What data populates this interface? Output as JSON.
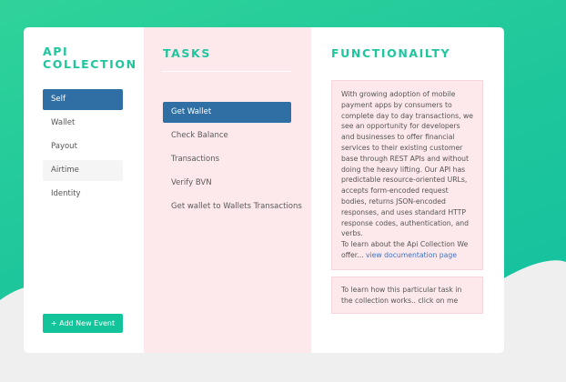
{
  "api": {
    "title": "API COLLECTION",
    "items": [
      {
        "label": "Self",
        "state": "active"
      },
      {
        "label": "Wallet",
        "state": ""
      },
      {
        "label": "Payout",
        "state": ""
      },
      {
        "label": "Airtime",
        "state": "hover"
      },
      {
        "label": "Identity",
        "state": ""
      }
    ],
    "add_button": "+ Add New Event"
  },
  "tasks": {
    "title": "TASKS",
    "items": [
      {
        "label": "Get Wallet",
        "state": "active"
      },
      {
        "label": "Check Balance",
        "state": ""
      },
      {
        "label": "Transactions",
        "state": ""
      },
      {
        "label": "Verify BVN",
        "state": ""
      },
      {
        "label": "Get wallet to Wallets Transactions",
        "state": ""
      }
    ]
  },
  "functionality": {
    "title": "FUNCTIONAILTY",
    "description": "With growing adoption of mobile payment apps by consumers to complete day to day transactions, we see an opportunity for developers and businesses to offer financial services to their existing customer base through REST APIs and without doing the heavy lifting. Our API has predictable resource-oriented URLs, accepts form-encoded request bodies, returns JSON-encoded responses, and uses standard HTTP response codes, authentication, and verbs.",
    "learn_more": "To learn about the Api Collection We offer...",
    "doc_link": "view documentation page",
    "task_help": "To learn how this particular task in the collection works.. click on me"
  },
  "colors": {
    "accent": "#1fc59d",
    "active": "#2f6fa4",
    "panel_pink": "#fde9ec",
    "link": "#3e72c4"
  }
}
